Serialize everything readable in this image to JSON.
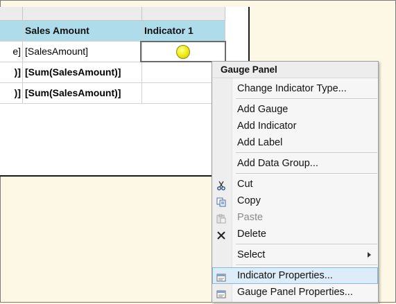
{
  "table": {
    "header": {
      "sales_amount": "Sales Amount",
      "indicator": "Indicator 1"
    },
    "rows": [
      {
        "left": "e]",
        "sales": "[SalesAmount]"
      },
      {
        "left": ")]",
        "sales": "[Sum(SalesAmount)]"
      },
      {
        "left": ")]",
        "sales": "[Sum(SalesAmount)]"
      }
    ]
  },
  "context_menu": {
    "title": "Gauge Panel",
    "items": [
      {
        "label": "Change Indicator Type...",
        "icon": ""
      },
      {
        "label": "Add Gauge",
        "icon": ""
      },
      {
        "label": "Add Indicator",
        "icon": ""
      },
      {
        "label": "Add Label",
        "icon": ""
      },
      {
        "label": "Add Data Group...",
        "icon": ""
      },
      {
        "label": "Cut",
        "icon": "scissors-icon"
      },
      {
        "label": "Copy",
        "icon": "copy-icon"
      },
      {
        "label": "Paste",
        "icon": "paste-icon"
      },
      {
        "label": "Delete",
        "icon": "delete-x-icon"
      },
      {
        "label": "Select",
        "icon": ""
      },
      {
        "label": "Indicator Properties...",
        "icon": "properties-icon"
      },
      {
        "label": "Gauge Panel Properties...",
        "icon": "properties-icon"
      }
    ]
  },
  "colors": {
    "canvas": "#fdf8e6",
    "header_fill": "#aedcea",
    "indicator_state": "#f2ef1c",
    "menu_highlight": "#dcecf8"
  }
}
